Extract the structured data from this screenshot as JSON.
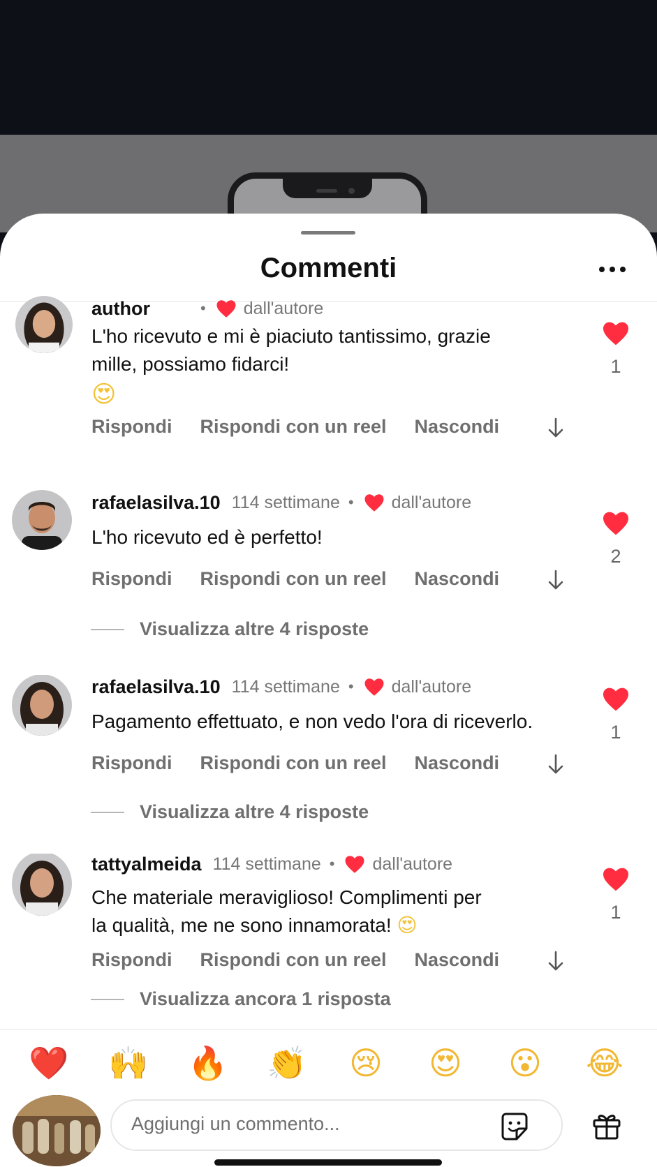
{
  "sheet": {
    "title": "Commenti"
  },
  "comments": [
    {
      "username": "author",
      "time": "",
      "by_author": "dall'autore",
      "text_lines": [
        "L'ho ricevuto e mi è piaciuto tantissimo, grazie",
        "mille, possiamo fidarci!"
      ],
      "emoji_line": "😍",
      "likes": "1",
      "actions": [
        "Rispondi",
        "Rispondi con un reel",
        "Nascondi"
      ]
    },
    {
      "username": "rafaelasilva.10",
      "time": "114 settimane",
      "by_author": "dall'autore",
      "text_lines": [
        "L'ho ricevuto ed è perfetto!"
      ],
      "likes": "2",
      "actions": [
        "Rispondi",
        "Rispondi con un reel",
        "Nascondi"
      ],
      "view_replies": "Visualizza altre 4 risposte"
    },
    {
      "username": "rafaelasilva.10",
      "time": "114 settimane",
      "by_author": "dall'autore",
      "text_lines": [
        "Pagamento effettuato, e non vedo l'ora di riceverlo."
      ],
      "likes": "1",
      "actions": [
        "Rispondi",
        "Rispondi con un reel",
        "Nascondi"
      ],
      "view_replies": "Visualizza altre 4 risposte"
    },
    {
      "username": "tattyalmeida",
      "time": "114 settimane",
      "by_author": "dall'autore",
      "text_lines": [
        "Che materiale meraviglioso! Complimenti per",
        "la qualità, me ne sono innamorata!"
      ],
      "text_emoji": "😍",
      "likes": "1",
      "actions": [
        "Rispondi",
        "Rispondi con un reel",
        "Nascondi"
      ],
      "view_replies": "Visualizza ancora 1 risposta"
    }
  ],
  "reactions": [
    "❤️",
    "🙌",
    "🔥",
    "👏",
    "😢",
    "😍",
    "😮",
    "😂"
  ],
  "composer": {
    "placeholder": "Aggiungi un commento..."
  },
  "icons": {
    "more": "more-horizontal-icon",
    "heart": "heart-icon",
    "down": "arrow-down-icon",
    "sticker": "sticker-icon",
    "gift": "gift-icon"
  },
  "colors": {
    "heart": "#ff2d3f",
    "muted_text": "#6f6f6f",
    "background_dark": "#0d1017"
  }
}
